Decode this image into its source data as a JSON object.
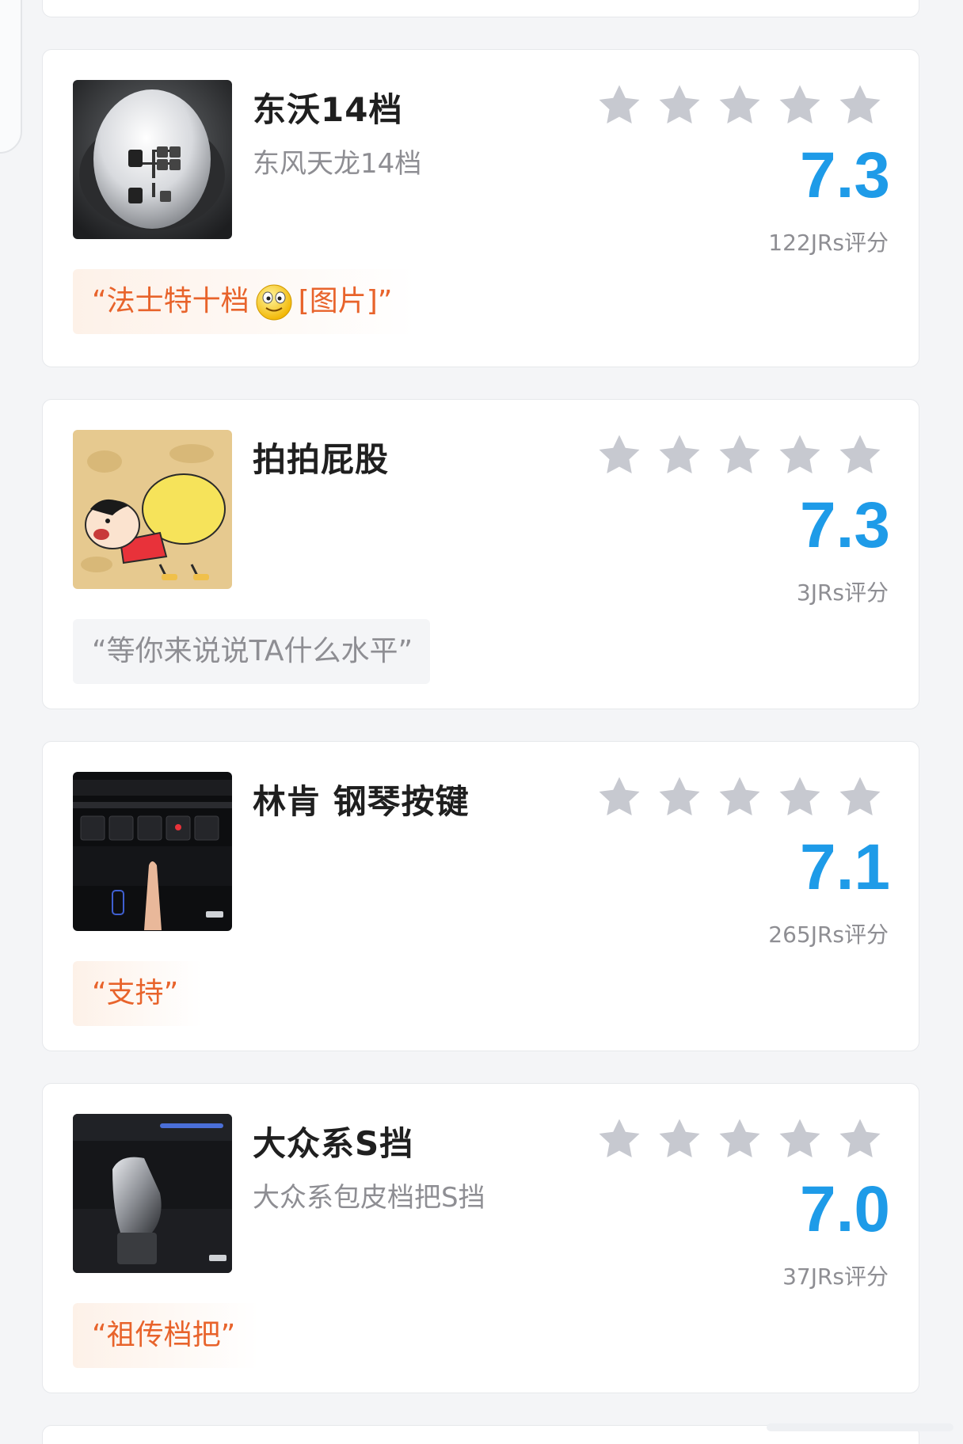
{
  "cards": [
    {
      "title": "东沃14档",
      "subtitle": "东风天龙14档",
      "rating": "7.3",
      "votes": "122JRs评分",
      "comment_prefix": "“法士特十档",
      "comment_suffix": "[图片]”",
      "comment_style": "hot",
      "thumb_icon": "gear-shifter-14-speed"
    },
    {
      "title": "拍拍屁股",
      "subtitle": "",
      "rating": "7.3",
      "votes": "3JRs评分",
      "comment": "“等你来说说TA什么水平”",
      "comment_style": "empty",
      "thumb_icon": "cartoon-character"
    },
    {
      "title": "林肯 钢琴按键",
      "subtitle": "",
      "rating": "7.1",
      "votes": "265JRs评分",
      "comment": "“支持”",
      "comment_style": "hot",
      "thumb_icon": "piano-key-shifter"
    },
    {
      "title": "大众系S挡",
      "subtitle": "大众系包皮档把S挡",
      "rating": "7.0",
      "votes": "37JRs评分",
      "comment": "“祖传档把”",
      "comment_style": "hot",
      "thumb_icon": "gear-lever-s"
    }
  ],
  "colors": {
    "score": "#1e9be8",
    "hot_comment": "#e8632b",
    "star": "#c7c9d0",
    "background": "#f4f5f7"
  }
}
